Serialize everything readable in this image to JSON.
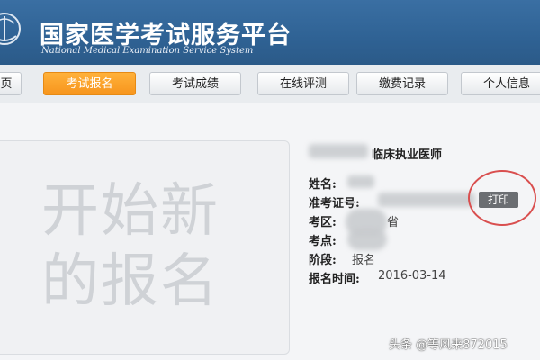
{
  "header": {
    "title": "国家医学考试服务平台",
    "subtitle": "National Medical Examination Service System",
    "brand_color": "#2f6294"
  },
  "nav": {
    "tabs": [
      {
        "label": "页",
        "active": false
      },
      {
        "label": "考试报名",
        "active": true
      },
      {
        "label": "考试成绩",
        "active": false
      },
      {
        "label": "在线评测",
        "active": false
      },
      {
        "label": "缴费记录",
        "active": false
      },
      {
        "label": "个人信息",
        "active": false
      }
    ],
    "active_color": "#f7951d"
  },
  "registration": {
    "new_label_line1": "开始新",
    "new_label_line2": "的报名"
  },
  "info": {
    "exam_type": "临床执业医师",
    "name_label": "姓名:",
    "ticket_label": "准考证号:",
    "area_label": "考区:",
    "area_value_suffix": "省",
    "site_label": "考点:",
    "stage_label": "阶段:",
    "stage_value": "报名",
    "time_label": "报名时间:",
    "time_value": "2016-03-14",
    "print_label": "打印"
  },
  "watermark": {
    "text": "头条 @等风来872015"
  }
}
